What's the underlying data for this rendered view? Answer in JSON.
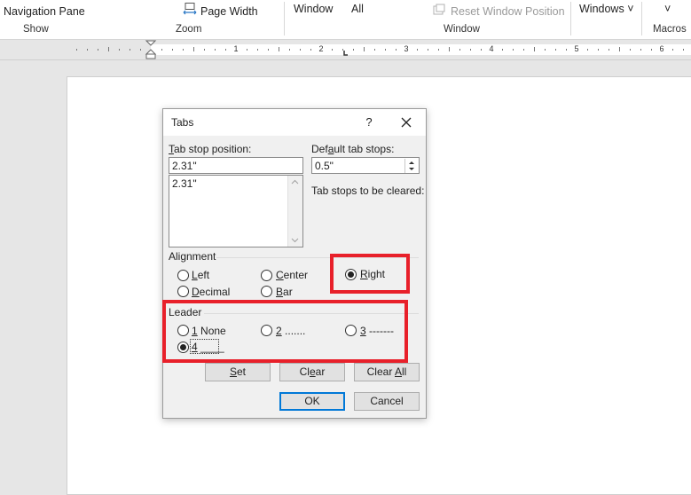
{
  "ribbon": {
    "navigation_pane": "Navigation Pane",
    "page_width": "Page Width",
    "window": "Window",
    "all": "All",
    "reset_window_position": "Reset Window Position",
    "windows": "Windows",
    "windows_caret": "˅",
    "macros_caret": "˅",
    "groups": {
      "show": "Show",
      "zoom": "Zoom",
      "window": "Window",
      "macros": "Macros"
    }
  },
  "ruler": {
    "numbers": [
      "1",
      "2",
      "3",
      "4",
      "5",
      "6"
    ]
  },
  "dialog": {
    "title": "Tabs",
    "help": "?",
    "tab_stop_position_label": [
      "T",
      "ab stop position:"
    ],
    "tab_stop_position_value": "2.31\"",
    "tab_stop_list": [
      "2.31\""
    ],
    "default_tab_stops_label": [
      "Def",
      "a",
      "ult tab stops:"
    ],
    "default_tab_stops_value": "0.5\"",
    "tab_stops_cleared_label": "Tab stops to be cleared:",
    "alignment_label": "Alignment",
    "alignment": [
      {
        "key": "L",
        "rest": "eft",
        "checked": false
      },
      {
        "key": "C",
        "rest": "enter",
        "checked": false
      },
      {
        "key": "R",
        "rest": "ight",
        "checked": true
      },
      {
        "key": "D",
        "rest": "ecimal",
        "checked": false
      },
      {
        "key": "B",
        "rest": "ar",
        "checked": false
      }
    ],
    "leader_label": "Leader",
    "leader": [
      {
        "key": "1",
        "rest": " None",
        "checked": false
      },
      {
        "key": "2",
        "rest": " .......",
        "checked": false
      },
      {
        "key": "3",
        "rest": " -------",
        "checked": false
      },
      {
        "key": "4",
        "rest": " ____",
        "checked": true
      }
    ],
    "buttons": {
      "set": [
        "",
        "S",
        "et"
      ],
      "clear": [
        "Cl",
        "e",
        "ar"
      ],
      "clear_all": [
        "Clear ",
        "A",
        "ll"
      ],
      "ok": "OK",
      "cancel": "Cancel"
    }
  },
  "highlight_color": "#e8202a"
}
